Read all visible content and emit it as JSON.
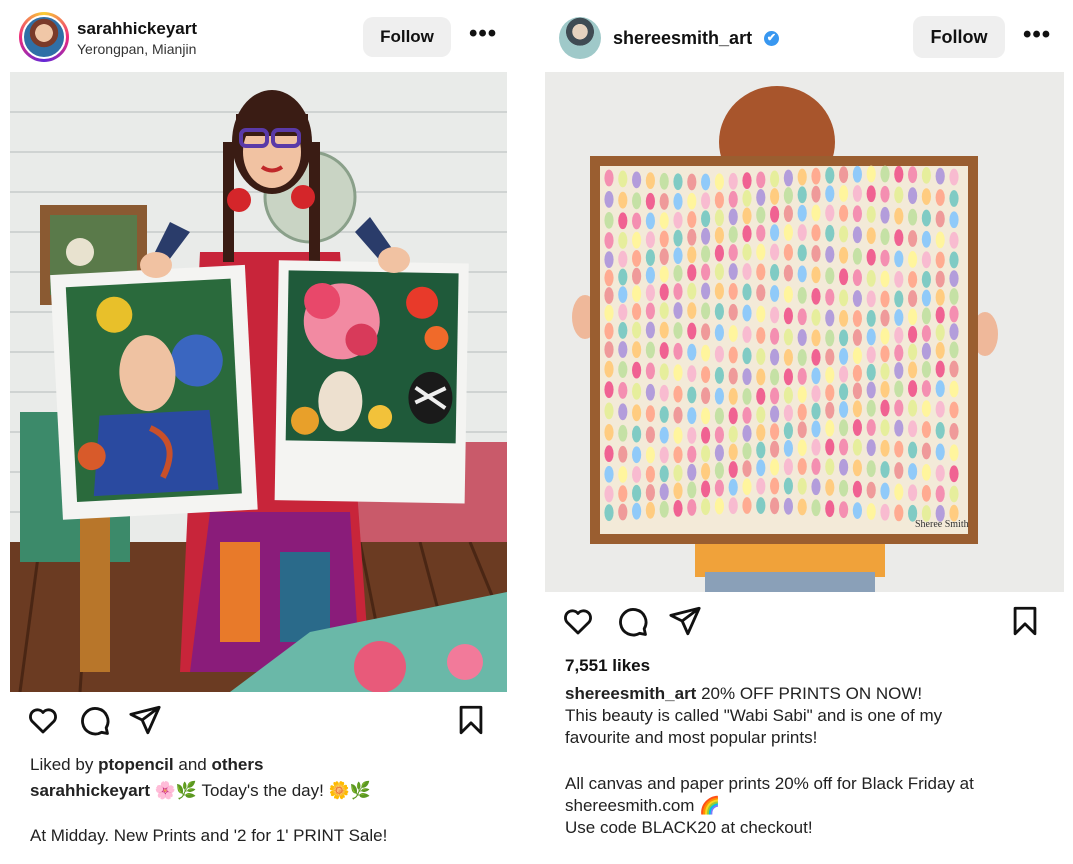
{
  "posts": [
    {
      "username": "sarahhickeyart",
      "location": "Yerongpan, Mianjin",
      "follow_label": "Follow",
      "more_label": "•••",
      "liked_by_prefix": "Liked by",
      "liked_by_user": "ptopencil",
      "liked_by_and": "and",
      "liked_by_others": "others",
      "caption_user": "sarahhickeyart",
      "caption_text": "🌸🌿 Today's the day! 🌼🌿",
      "caption_line2": "At Midday. New Prints and '2 for 1' PRINT Sale!"
    },
    {
      "username": "shereesmith_art",
      "verified_mark": "✔",
      "follow_label": "Follow",
      "more_label": "•••",
      "likes": "7,551 likes",
      "caption_user": "shereesmith_art",
      "caption_line1": "20% OFF PRINTS ON NOW!",
      "caption_line2": "This beauty is called \"Wabi Sabi\" and is one of my",
      "caption_line3": "favourite and most popular prints!",
      "caption_line4": "All canvas and paper prints 20% off for Black Friday at",
      "caption_line5": "shereesmith.com 🌈",
      "caption_line6": "Use code BLACK20 at checkout!",
      "painting_signature": "Sheree Smith"
    }
  ]
}
